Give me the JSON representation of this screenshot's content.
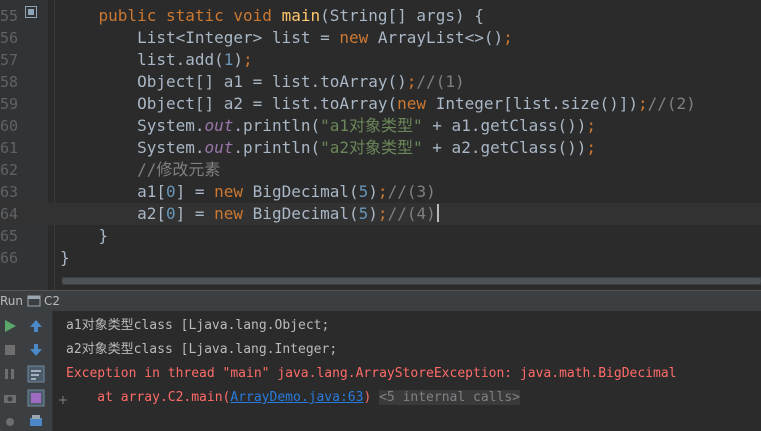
{
  "editor": {
    "lines": [
      {
        "num": "55",
        "tokens": [
          [
            "plain",
            "    "
          ],
          [
            "kw",
            "public static void "
          ],
          [
            "fn",
            "main"
          ],
          [
            "plain",
            "(String[] args) {"
          ]
        ]
      },
      {
        "num": "56",
        "tokens": [
          [
            "plain",
            "        List<Integer> list = "
          ],
          [
            "kw",
            "new "
          ],
          [
            "plain",
            "ArrayList<>()"
          ],
          [
            "kw",
            ";"
          ]
        ]
      },
      {
        "num": "57",
        "tokens": [
          [
            "plain",
            "        list.add("
          ],
          [
            "num",
            "1"
          ],
          [
            "plain",
            ")"
          ],
          [
            "kw",
            ";"
          ]
        ]
      },
      {
        "num": "58",
        "tokens": [
          [
            "plain",
            "        Object[] a1 = list.toArray()"
          ],
          [
            "kw",
            ";"
          ],
          [
            "cmt",
            "//(1)"
          ]
        ]
      },
      {
        "num": "59",
        "tokens": [
          [
            "plain",
            "        Object[] a2 = list.toArray("
          ],
          [
            "kw",
            "new "
          ],
          [
            "plain",
            "Integer[list.size()])"
          ],
          [
            "kw",
            ";"
          ],
          [
            "cmt",
            "//(2)"
          ]
        ]
      },
      {
        "num": "60",
        "tokens": [
          [
            "plain",
            "        System."
          ],
          [
            "field",
            "out"
          ],
          [
            "plain",
            ".println("
          ],
          [
            "str",
            "\"a1对象类型\""
          ],
          [
            "plain",
            " + a1.getClass())"
          ],
          [
            "kw",
            ";"
          ]
        ]
      },
      {
        "num": "61",
        "tokens": [
          [
            "plain",
            "        System."
          ],
          [
            "field",
            "out"
          ],
          [
            "plain",
            ".println("
          ],
          [
            "str",
            "\"a2对象类型\""
          ],
          [
            "plain",
            " + a2.getClass())"
          ],
          [
            "kw",
            ";"
          ]
        ]
      },
      {
        "num": "62",
        "tokens": [
          [
            "cmt",
            "        //修改元素"
          ]
        ]
      },
      {
        "num": "63",
        "tokens": [
          [
            "plain",
            "        a1["
          ],
          [
            "num",
            "0"
          ],
          [
            "plain",
            "] = "
          ],
          [
            "kw",
            "new "
          ],
          [
            "plain",
            "BigDecimal("
          ],
          [
            "num",
            "5"
          ],
          [
            "plain",
            ")"
          ],
          [
            "kw",
            ";"
          ],
          [
            "cmt",
            "//(3)"
          ]
        ]
      },
      {
        "num": "64",
        "tokens": [
          [
            "plain",
            "        a2["
          ],
          [
            "num",
            "0"
          ],
          [
            "plain",
            "] = "
          ],
          [
            "kw",
            "new "
          ],
          [
            "plain",
            "BigDecimal("
          ],
          [
            "num",
            "5"
          ],
          [
            "plain",
            ")"
          ],
          [
            "kw",
            ";"
          ],
          [
            "cmt",
            "//(4)"
          ]
        ],
        "current": true
      },
      {
        "num": "65",
        "tokens": [
          [
            "plain",
            "    }"
          ]
        ]
      },
      {
        "num": "66",
        "tokens": [
          [
            "plain",
            "}"
          ]
        ]
      }
    ]
  },
  "run_panel": {
    "title": "Run",
    "config_name": "C2"
  },
  "console": {
    "line1": "a1对象类型class [Ljava.lang.Object;",
    "line2": "a2对象类型class [Ljava.lang.Integer;",
    "line3": "Exception in thread \"main\" java.lang.ArrayStoreException: java.math.BigDecimal",
    "trace_prefix": "    at array.C2.main(",
    "trace_link": "ArrayDemo.java:63",
    "trace_suffix": ")",
    "internal_calls": "<5 internal calls>"
  },
  "icons": {
    "run": "play-icon",
    "stop": "stop-icon",
    "pause": "pause-icon",
    "up": "arrow-up-icon",
    "down": "arrow-down-icon",
    "wrap": "soft-wrap-icon",
    "scroll_end": "scroll-to-end-icon",
    "print": "print-icon",
    "camera": "dump-threads-icon"
  },
  "colors": {
    "keyword": "#cc7832",
    "function": "#ffc66d",
    "number": "#6897bb",
    "string": "#6a8759",
    "comment": "#808080",
    "field": "#9876aa",
    "error": "#ff6b68",
    "link": "#287bde"
  }
}
